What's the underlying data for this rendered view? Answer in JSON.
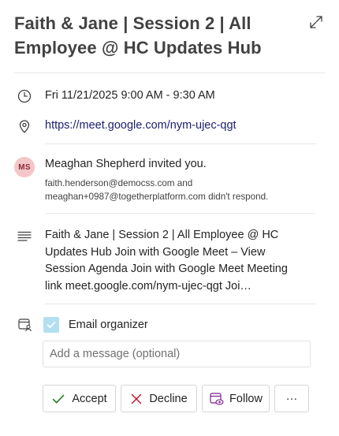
{
  "event": {
    "title": "Faith & Jane | Session 2 | All Employee @ HC Updates Hub",
    "datetime": "Fri 11/21/2025 9:00 AM - 9:30 AM",
    "location_link": "https://meet.google.com/nym-ujec-qgt"
  },
  "invite": {
    "avatar_initials": "MS",
    "invited_text": "Meaghan Shepherd invited you.",
    "responses_line1": "faith.henderson@democss.com and",
    "responses_line2": "meaghan+0987@togetherplatform.com didn't respond."
  },
  "description": "Faith & Jane | Session 2 | All Employee @ HC Updates Hub Join with Google Meet – View Session Agenda Join with Google Meet Meeting link meet.google.com/nym-ujec-qgt Joi…",
  "organizer": {
    "email_checkbox_label": "Email organizer",
    "checked": true,
    "message_placeholder": "Add a message (optional)"
  },
  "actions": {
    "accept": "Accept",
    "decline": "Decline",
    "follow": "Follow",
    "more": "···"
  },
  "icons": {
    "expand": "expand-icon",
    "clock": "clock-icon",
    "location": "location-pin-icon",
    "notes": "notes-icon",
    "organizer": "calendar-person-icon",
    "accept": "checkmark-icon",
    "decline": "x-icon",
    "follow": "calendar-eye-icon"
  },
  "colors": {
    "accept_check": "#107c10",
    "decline_x": "#c50f1f",
    "follow_icon": "#7c1d8e",
    "link": "#1b1f6d",
    "checkbox_fill": "#b4dff0",
    "avatar_bg": "#f4c6c7"
  }
}
